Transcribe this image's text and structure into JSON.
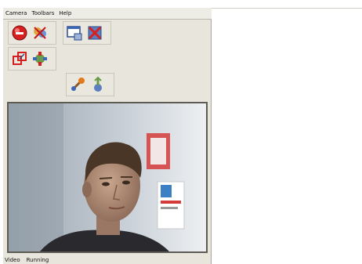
{
  "menubar": {
    "items": [
      "Camera",
      "Toolbars",
      "Help"
    ]
  },
  "toolbar": {
    "icons": [
      "record-icon",
      "effects-icon",
      "window-settings-icon",
      "disconnect-icon",
      "resize-icon",
      "refresh-icon",
      "tools-icon",
      "upload-icon"
    ]
  },
  "statusbar": {
    "field1": "Video",
    "field2": "Running"
  },
  "colors": {
    "panel_bg": "#e7e5dc",
    "accent_red": "#d62020"
  }
}
